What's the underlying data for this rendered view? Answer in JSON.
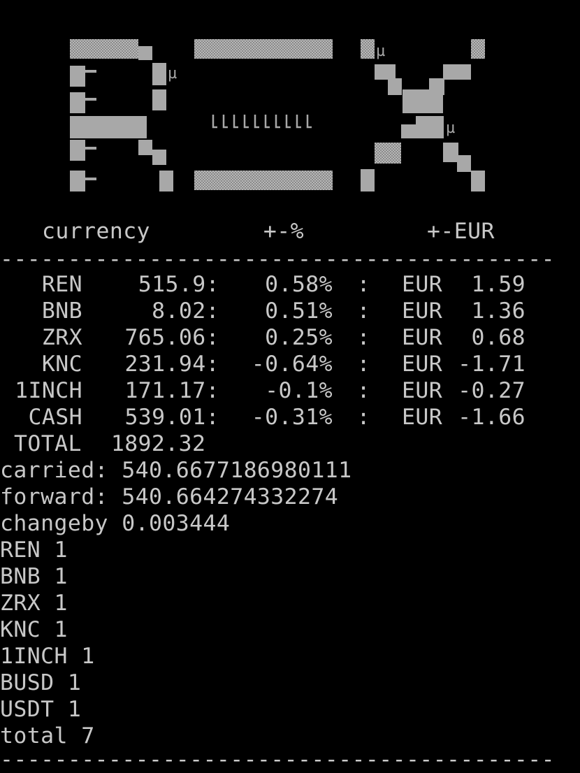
{
  "header": {
    "col_currency": "currency",
    "col_pct": "+-%",
    "col_eur": "+-EUR"
  },
  "separator": "-----------------------------------------",
  "rows": [
    {
      "sym": "REN",
      "amount": "515.9:",
      "pct": "0.58%",
      "sep": ":",
      "cur": "EUR",
      "eur": "1.59"
    },
    {
      "sym": "BNB",
      "amount": "8.02:",
      "pct": "0.51%",
      "sep": ":",
      "cur": "EUR",
      "eur": "1.36"
    },
    {
      "sym": "ZRX",
      "amount": "765.06:",
      "pct": "0.25%",
      "sep": ":",
      "cur": "EUR",
      "eur": "0.68"
    },
    {
      "sym": "KNC",
      "amount": "231.94:",
      "pct": "-0.64%",
      "sep": ":",
      "cur": "EUR",
      "eur": "-1.71"
    },
    {
      "sym": "1INCH",
      "amount": "171.17:",
      "pct": "-0.1%",
      "sep": ":",
      "cur": "EUR",
      "eur": "-0.27"
    },
    {
      "sym": "CASH",
      "amount": "539.01:",
      "pct": "-0.31%",
      "sep": ":",
      "cur": "EUR",
      "eur": "-1.66"
    }
  ],
  "total": {
    "label": "TOTAL",
    "value": "1892.32"
  },
  "log_lines": [
    "carried: 540.6677186980111",
    "forward: 540.664274332274",
    "changeby 0.003444",
    "REN 1",
    "BNB 1",
    "ZRX 1",
    "KNC 1",
    "1INCH 1",
    "BUSD 1",
    "USDT 1",
    "total 7"
  ],
  "colors": {
    "background": "#000000",
    "text": "#c8c8c8",
    "logo_block": "#a8a8a8"
  }
}
